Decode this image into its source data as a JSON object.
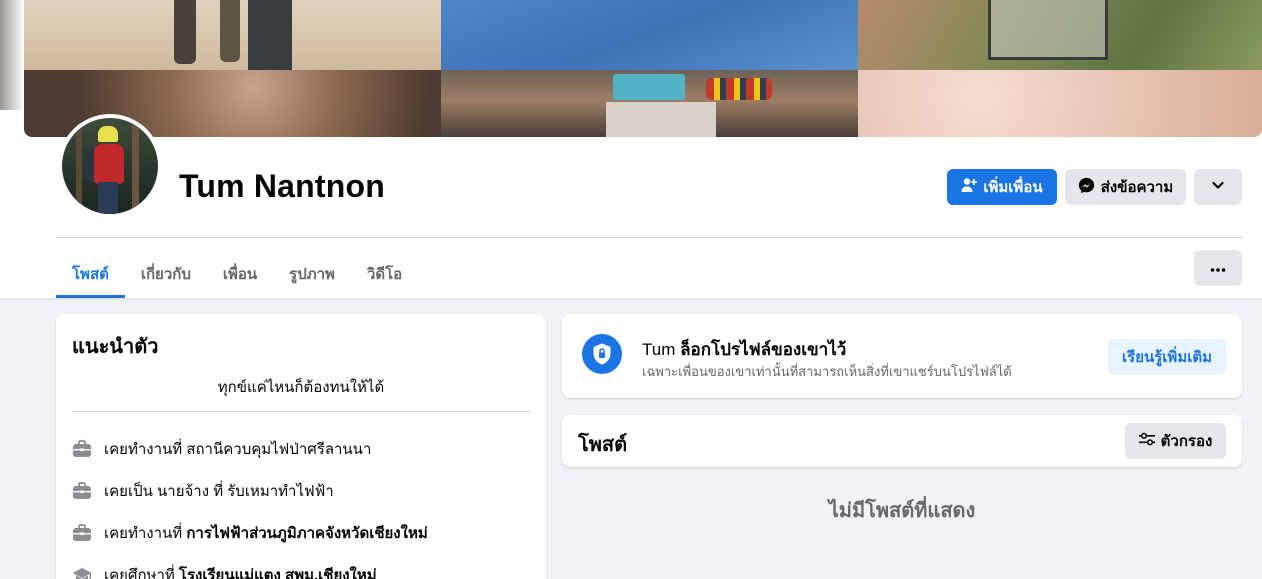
{
  "profile": {
    "name": "Tum Nantnon"
  },
  "actions": {
    "add_friend": "เพิ่มเพื่อน",
    "message": "ส่งข้อความ"
  },
  "tabs": [
    {
      "label": "โพสต์",
      "active": true
    },
    {
      "label": "เกี่ยวกับ",
      "active": false
    },
    {
      "label": "เพื่อน",
      "active": false
    },
    {
      "label": "รูปภาพ",
      "active": false
    },
    {
      "label": "วิดีโอ",
      "active": false
    }
  ],
  "intro": {
    "title": "แนะนำตัว",
    "bio": "ทุกข์แค่ไหนก็ต้องทนให้ได้",
    "items": [
      {
        "icon": "briefcase-icon",
        "prefix": "เคยทำงานที่ สถานีควบคุมไฟป่าศรีลานนา",
        "bold": ""
      },
      {
        "icon": "briefcase-icon",
        "prefix": "เคยเป็น นายจ้าง ที่ รับเหมาทำไฟฟ้า",
        "bold": ""
      },
      {
        "icon": "briefcase-icon",
        "prefix": "เคยทำงานที่ ",
        "bold": "การไฟฟ้าส่วนภูมิภาคจังหวัดเชียงใหม่"
      },
      {
        "icon": "graduation-cap-icon",
        "prefix": "เคยศึกษาที่ ",
        "bold": "โรงเรียนแม่แตง สพม.เชียงใหม่"
      }
    ]
  },
  "lock_notice": {
    "name": "Tum",
    "title_rest": "ล็อกโปรไฟล์ของเขาไว้",
    "subtitle": "เฉพาะเพื่อนของเขาเท่านั้นที่สามารถเห็นสิ่งที่เขาแชร์บนโปรไฟล์ได้",
    "learn_more": "เรียนรู้เพิ่มเติม"
  },
  "posts": {
    "title": "โพสต์",
    "filter": "ตัวกรอง",
    "empty": "ไม่มีโพสต์ที่แสดง"
  },
  "colors": {
    "primary": "#1b74e4",
    "secondary_bg": "#e4e6eb",
    "page_bg": "#f0f2f5",
    "muted_text": "#65676b"
  }
}
